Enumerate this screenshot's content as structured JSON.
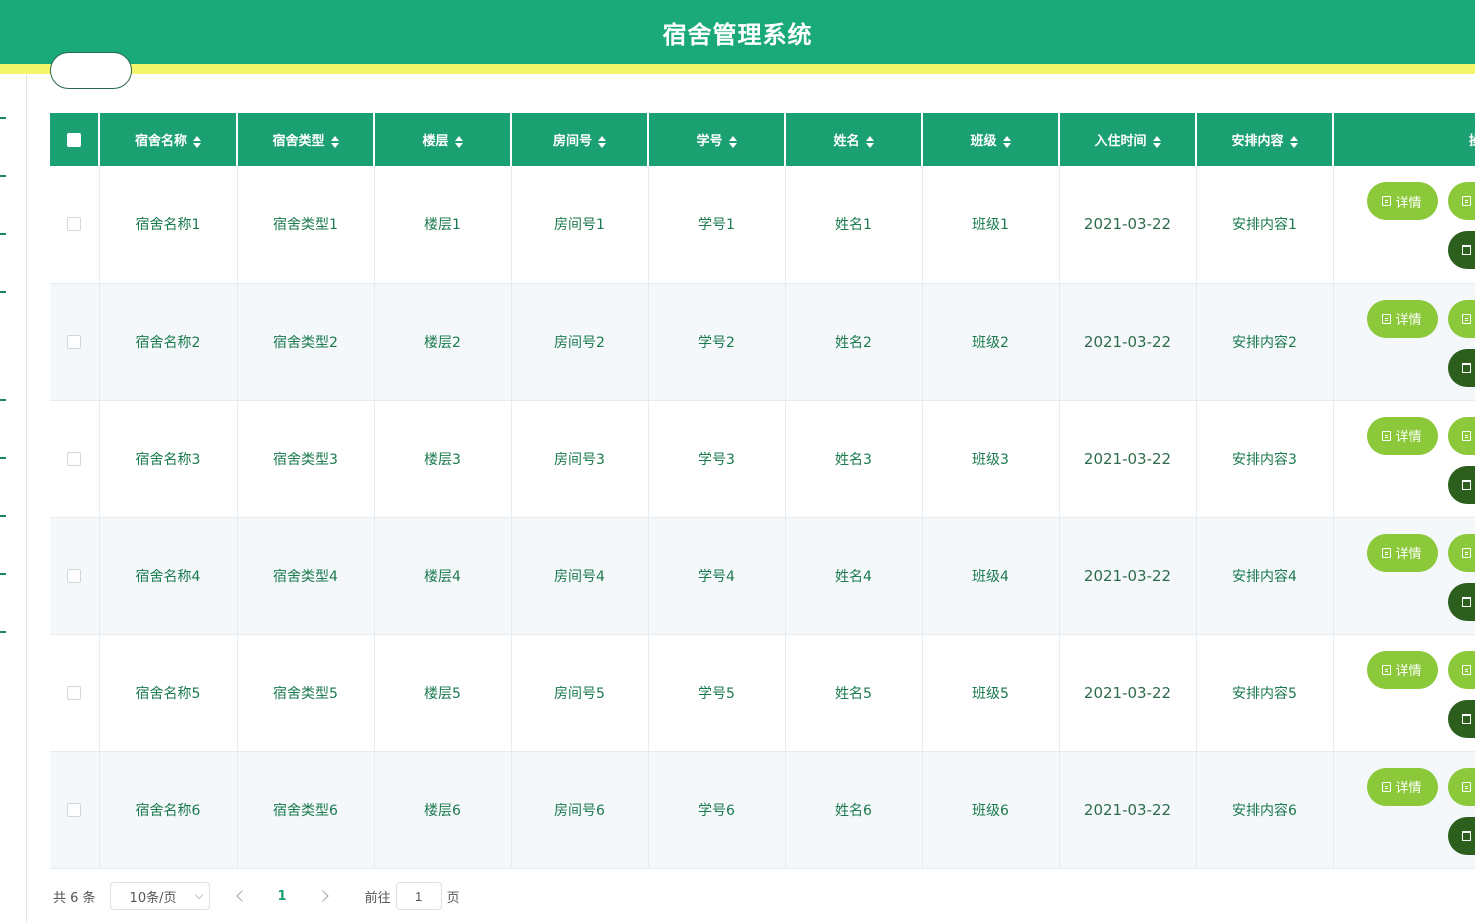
{
  "app": {
    "title": "宿舍管理系统"
  },
  "table": {
    "columns": [
      "宿舍名称",
      "宿舍类型",
      "楼层",
      "房间号",
      "学号",
      "姓名",
      "班级",
      "入住时间",
      "安排内容",
      "操作"
    ],
    "rows": [
      {
        "name": "宿舍名称1",
        "type": "宿舍类型1",
        "floor": "楼层1",
        "room": "房间号1",
        "student_no": "学号1",
        "student_name": "姓名1",
        "class": "班级1",
        "checkin": "2021-03-22",
        "arrangement": "安排内容1"
      },
      {
        "name": "宿舍名称2",
        "type": "宿舍类型2",
        "floor": "楼层2",
        "room": "房间号2",
        "student_no": "学号2",
        "student_name": "姓名2",
        "class": "班级2",
        "checkin": "2021-03-22",
        "arrangement": "安排内容2"
      },
      {
        "name": "宿舍名称3",
        "type": "宿舍类型3",
        "floor": "楼层3",
        "room": "房间号3",
        "student_no": "学号3",
        "student_name": "姓名3",
        "class": "班级3",
        "checkin": "2021-03-22",
        "arrangement": "安排内容3"
      },
      {
        "name": "宿舍名称4",
        "type": "宿舍类型4",
        "floor": "楼层4",
        "room": "房间号4",
        "student_no": "学号4",
        "student_name": "姓名4",
        "class": "班级4",
        "checkin": "2021-03-22",
        "arrangement": "安排内容4"
      },
      {
        "name": "宿舍名称5",
        "type": "宿舍类型5",
        "floor": "楼层5",
        "room": "房间号5",
        "student_no": "学号5",
        "student_name": "姓名5",
        "class": "班级5",
        "checkin": "2021-03-22",
        "arrangement": "安排内容5"
      },
      {
        "name": "宿舍名称6",
        "type": "宿舍类型6",
        "floor": "楼层6",
        "room": "房间号6",
        "student_no": "学号6",
        "student_name": "姓名6",
        "class": "班级6",
        "checkin": "2021-03-22",
        "arrangement": "安排内容6"
      }
    ],
    "actions": {
      "detail_label": "详情"
    }
  },
  "pagination": {
    "total_text": "共 6 条",
    "page_size": "10条/页",
    "current_page": "1",
    "goto_label": "前往",
    "goto_value": "1",
    "page_suffix": "页"
  },
  "colors": {
    "header_bg": "#1aaa7a",
    "accent_strip": "#f3f56b",
    "table_header": "#1aa071",
    "detail_button": "#8bc83a",
    "delete_button": "#2c5e1e",
    "cell_text": "#1b7a4e"
  },
  "icons": [
    "document-icon",
    "trash-icon",
    "sort-icon",
    "chevron-left-icon",
    "chevron-right-icon",
    "chevron-down-icon"
  ]
}
